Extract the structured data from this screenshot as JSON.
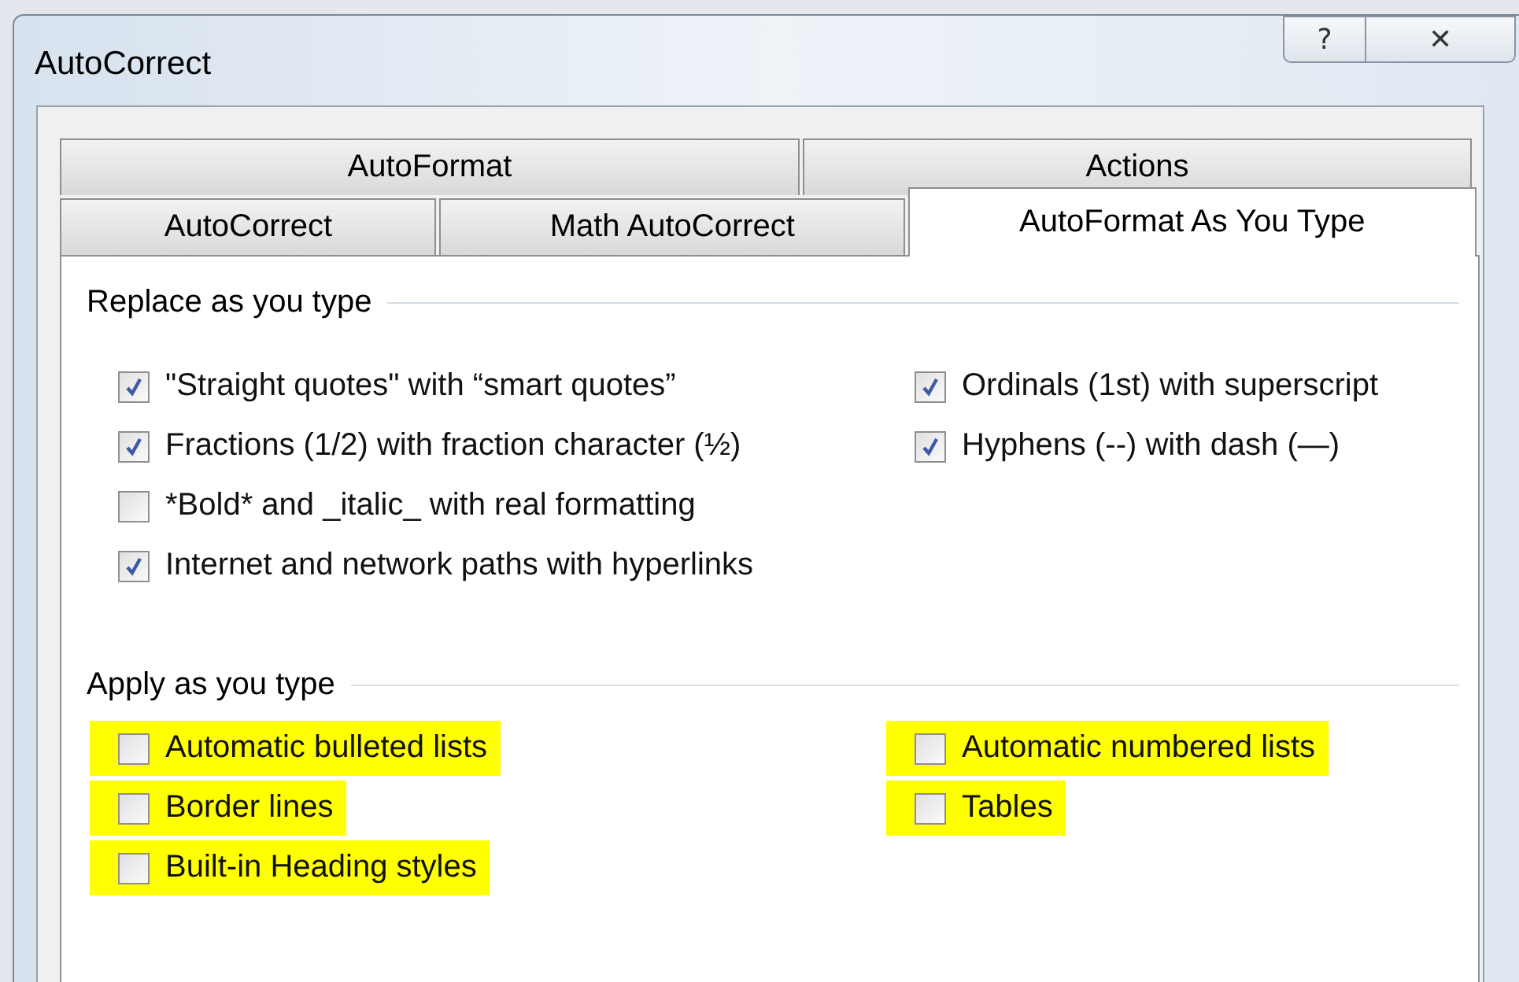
{
  "window": {
    "title": "AutoCorrect",
    "buttons": [
      {
        "kind": "help",
        "label": "?"
      },
      {
        "kind": "close",
        "label": "✕"
      }
    ]
  },
  "tabs": [
    [
      {
        "label": "AutoFormat",
        "selected": false
      },
      {
        "label": "Actions",
        "selected": false
      }
    ],
    [
      {
        "label": "AutoCorrect",
        "selected": false
      },
      {
        "label": "Math AutoCorrect",
        "selected": false
      },
      {
        "label": "AutoFormat As You Type",
        "selected": true
      }
    ]
  ],
  "groups": [
    {
      "title": "Replace as you type",
      "columns": [
        [
          {
            "label": "\"Straight quotes\" with “smart quotes”",
            "checked": true,
            "highlighted": false
          },
          {
            "label": "Fractions (1/2) with fraction character (½)",
            "checked": true,
            "highlighted": false
          },
          {
            "label": "*Bold* and _italic_ with real formatting",
            "checked": false,
            "highlighted": false
          },
          {
            "label": "Internet and network paths with hyperlinks",
            "checked": true,
            "highlighted": false
          }
        ],
        [
          {
            "label": "Ordinals (1st) with superscript",
            "checked": true,
            "highlighted": false
          },
          {
            "label": "Hyphens (--) with dash (—)",
            "checked": true,
            "highlighted": false
          }
        ]
      ]
    },
    {
      "title": "Apply as you type",
      "columns": [
        [
          {
            "label": "Automatic bulleted lists",
            "checked": false,
            "highlighted": true
          },
          {
            "label": "Border lines",
            "checked": false,
            "highlighted": true
          },
          {
            "label": "Built-in Heading styles",
            "checked": false,
            "highlighted": true
          }
        ],
        [
          {
            "label": "Automatic numbered lists",
            "checked": false,
            "highlighted": true
          },
          {
            "label": "Tables",
            "checked": false,
            "highlighted": true
          }
        ]
      ]
    }
  ]
}
